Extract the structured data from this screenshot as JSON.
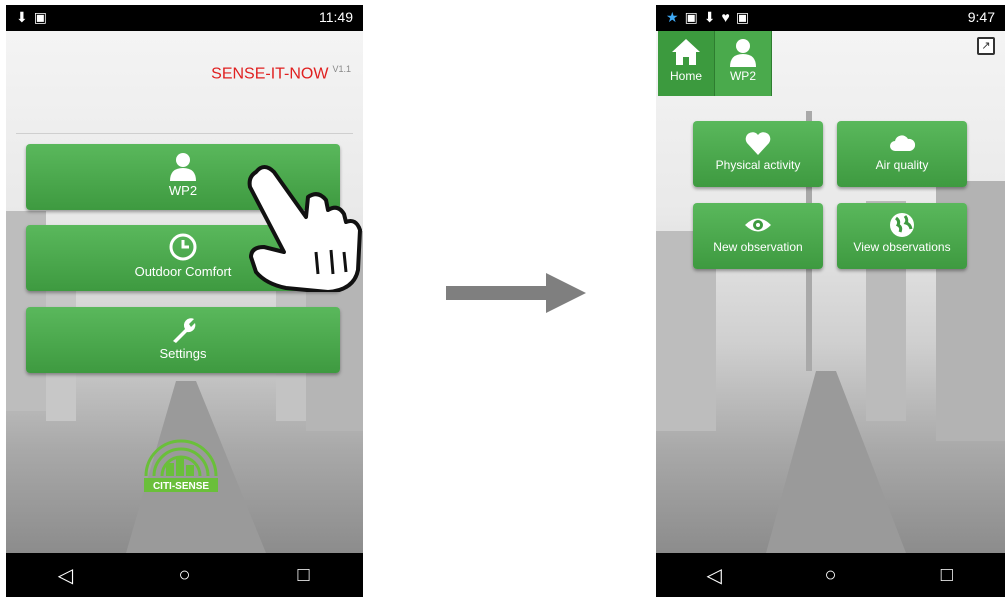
{
  "left_phone": {
    "status_time": "11:49",
    "app_name": "SENSE-IT-NOW",
    "version": "V1.1",
    "buttons": [
      {
        "label": "WP2",
        "icon": "user-icon"
      },
      {
        "label": "Outdoor Comfort",
        "icon": "clock-icon"
      },
      {
        "label": "Settings",
        "icon": "wrench-icon"
      }
    ],
    "logo_text": "CITI-SENSE"
  },
  "right_phone": {
    "status_time": "9:47",
    "tabs": [
      {
        "label": "Home",
        "icon": "home-icon"
      },
      {
        "label": "WP2",
        "icon": "user-icon"
      }
    ],
    "tiles": [
      {
        "label": "Physical activity",
        "icon": "heart-icon"
      },
      {
        "label": "Air quality",
        "icon": "cloud-icon"
      },
      {
        "label": "New observation",
        "icon": "eye-icon"
      },
      {
        "label": "View observations",
        "icon": "globe-icon"
      }
    ]
  },
  "nav": {
    "back": "◁",
    "home": "○",
    "recents": "□"
  },
  "colors": {
    "accent_green": "#4aa84c",
    "app_name_red": "#e02020",
    "status_bar": "#000000"
  }
}
